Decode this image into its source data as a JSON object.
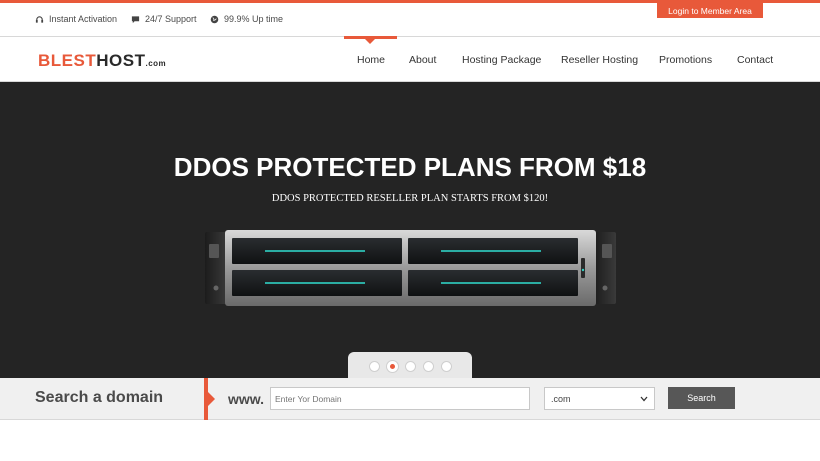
{
  "topbar": {
    "features": [
      {
        "label": "Instant Activation",
        "icon": "headset-icon"
      },
      {
        "label": "24/7 Support",
        "icon": "chat-bubble-icon"
      },
      {
        "label": "99.9% Up time",
        "icon": "globe-icon"
      }
    ],
    "login_label": "Login to Member Area"
  },
  "logo": {
    "part1": "BLEST",
    "part2": "HOST",
    "part3": ".com"
  },
  "nav": {
    "items": [
      {
        "label": "Home",
        "active": true
      },
      {
        "label": "About"
      },
      {
        "label": "Hosting Package"
      },
      {
        "label": "Reseller Hosting"
      },
      {
        "label": "Promotions"
      },
      {
        "label": "Contact"
      }
    ]
  },
  "hero": {
    "title": "DDOS PROTECTED PLANS FROM $18",
    "subtitle": "DDOS PROTECTED RESELLER PLAN STARTS FROM $120!",
    "slides": 5,
    "active_slide": 2
  },
  "domain_search": {
    "label": "Search a domain",
    "prefix": "www.",
    "placeholder": "Enter Yor Domain",
    "tld_selected": ".com",
    "button_label": "Search"
  },
  "colors": {
    "accent": "#e8593a",
    "hero_bg": "#242424",
    "button_dark": "#575757"
  }
}
